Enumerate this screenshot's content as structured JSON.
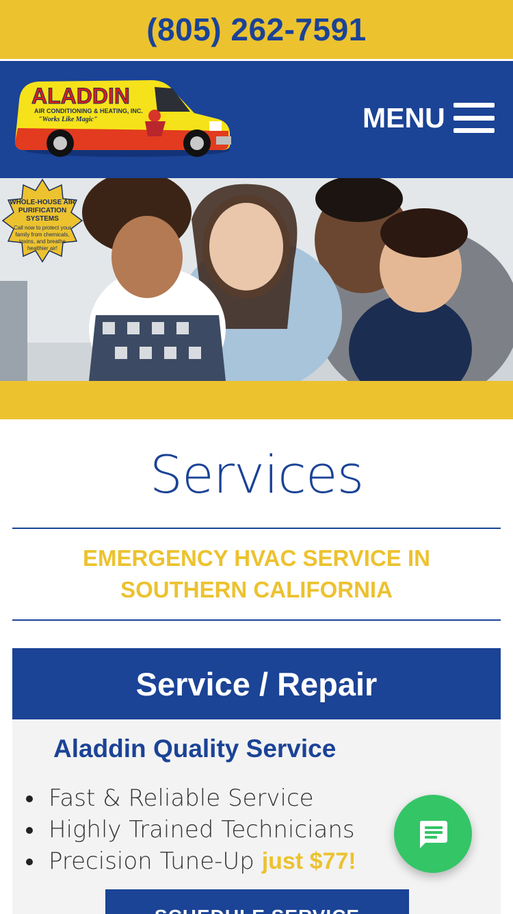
{
  "topbar": {
    "phone": "(805) 262-7591"
  },
  "header": {
    "logo": {
      "name": "ALADDIN",
      "sub": "AIR CONDITIONING & HEATING, INC.",
      "tagline": "\"Works Like Magic\""
    },
    "menu_label": "MENU"
  },
  "hero": {
    "badge_title": "WHOLE-HOUSE AIR PURIFICATION SYSTEMS",
    "badge_body": "Call now to protect your family from chemicals, toxins, and breathe healthier air!"
  },
  "page": {
    "title": "Services",
    "subtitle": "EMERGENCY HVAC SERVICE IN SOUTHERN CALIFORNIA"
  },
  "card": {
    "heading": "Service / Repair",
    "subheading": "Aladdin Quality Service",
    "features": [
      "Fast & Reliable Service",
      "Highly Trained Technicians"
    ],
    "tuneup_text": "Precision Tune-Up ",
    "tuneup_price": "just $77!",
    "cta_label": "SCHEDULE SERVICE"
  },
  "chat": {
    "icon": "chat-bubble-icon"
  },
  "colors": {
    "brand_blue": "#1b4396",
    "brand_yellow": "#ecc22f",
    "chat_green": "#34c567"
  }
}
